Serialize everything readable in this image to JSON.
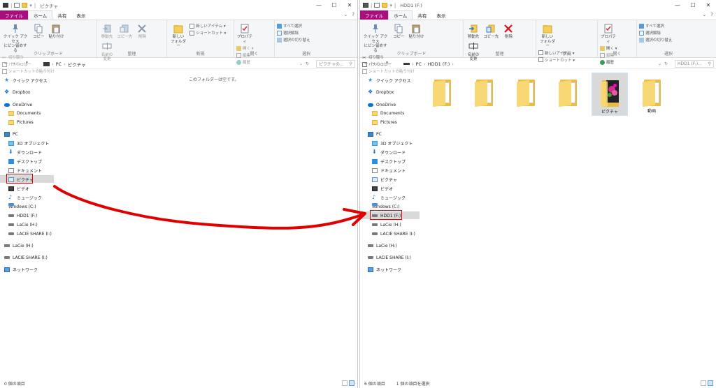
{
  "left": {
    "title": "ピクチャ",
    "tabs": {
      "file": "ファイル",
      "home": "ホーム",
      "share": "共有",
      "view": "表示"
    },
    "ribbon": {
      "pin": "クイック アクセス\nにピン留めする",
      "copy": "コピー",
      "paste": "貼り付け",
      "cut": "切り取り",
      "copy_path": "パスのコピー",
      "paste_shortcut": "ショートカットの貼り付け",
      "clipboard": "クリップボード",
      "move_to": "移動先",
      "copy_to": "コピー先",
      "delete": "削除",
      "rename": "名前の\n変更",
      "organize": "整理",
      "new_folder": "新しい\nフォルダー",
      "new_item": "新しいアイテム ▾",
      "shortcut": "ショートカット ▾",
      "new": "新規",
      "properties": "プロパティ",
      "open_menu": "開く ▾",
      "edit": "編集",
      "history": "履歴",
      "open": "開く",
      "select_all": "すべて選択",
      "select_none": "選択解除",
      "invert": "選択の切り替え",
      "select": "選択"
    },
    "path": [
      "PC",
      "ピクチャ"
    ],
    "search_placeholder": "ピクチャの...",
    "empty_message": "このフォルダーは空です。",
    "status": "0 個の項目"
  },
  "right": {
    "title": "HDD1 (F:)",
    "tabs": {
      "file": "ファイル",
      "home": "ホーム",
      "share": "共有",
      "view": "表示"
    },
    "ribbon": {
      "pin": "クイック アクセス\nにピン留めする",
      "copy": "コピー",
      "paste": "貼り付け",
      "cut": "切り取り",
      "copy_path": "パスのコピー",
      "paste_shortcut": "ショートカットの貼り付け",
      "clipboard": "クリップボード",
      "move_to": "移動先",
      "copy_to": "コピー先",
      "delete": "削除",
      "rename": "名前の\n変更",
      "organize": "整理",
      "new_folder": "新しい\nフォルダー",
      "new_item": "新しいアイテム ▾",
      "shortcut": "ショートカット ▾",
      "new": "新規",
      "properties": "プロパティ",
      "open_menu": "開く ▾",
      "edit": "編集",
      "history": "履歴",
      "open": "開く",
      "select_all": "すべて選択",
      "select_none": "選択解除",
      "invert": "選択の切り替え",
      "select": "選択"
    },
    "path": [
      "PC",
      "HDD1 (F:)"
    ],
    "search_placeholder": "HDD1 (F:)...",
    "folders": [
      "",
      "",
      "",
      "",
      "ピクチャ",
      "動画"
    ],
    "status": "6 個の項目",
    "status_selected": "1 個の項目を選択"
  },
  "nav": {
    "quick_access": "クイック アクセス",
    "dropbox": "Dropbox",
    "onedrive": "OneDrive",
    "documents": "Documents",
    "pictures": "Pictures",
    "pc": "PC",
    "objects3d": "3D オブジェクト",
    "downloads": "ダウンロード",
    "desktop": "デスクトップ",
    "docs_jp": "ドキュメント",
    "pictures_jp": "ピクチャ",
    "videos": "ビデオ",
    "music": "ミュージック",
    "windows_c": "Windows (C:)",
    "hdd1": "HDD1 (F:)",
    "lacie_h": "LaCie (H:)",
    "lacie_share_i": "LACIE SHARE (I:)",
    "lacie_h2": "LaCie (H:)",
    "lacie_share_i2": "LACIE SHARE (I:)",
    "network": "ネットワーク"
  },
  "colors": {
    "file_tab": "#a80e7c",
    "highlight": "#e00000",
    "selection": "#d9d9d9"
  }
}
